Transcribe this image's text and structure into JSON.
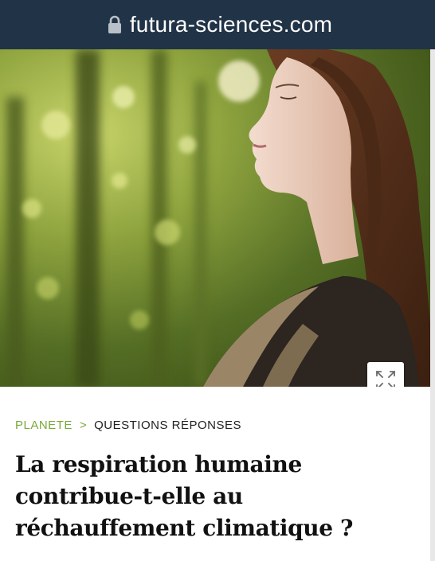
{
  "browser": {
    "url": "futura-sciences.com",
    "lock_icon": "lock-icon"
  },
  "hero": {
    "expand_icon": "expand-icon"
  },
  "article": {
    "breadcrumb": {
      "category": "PLANETE",
      "separator": ">",
      "section": "QUESTIONS RÉPONSES"
    },
    "title_lines": [
      "La respiration humaine",
      "contribue-t-elle au",
      "réchauffement climatique ?"
    ]
  },
  "colors": {
    "address_bar": "#203347",
    "category_green": "#7aa83a",
    "title_text": "#111111"
  }
}
